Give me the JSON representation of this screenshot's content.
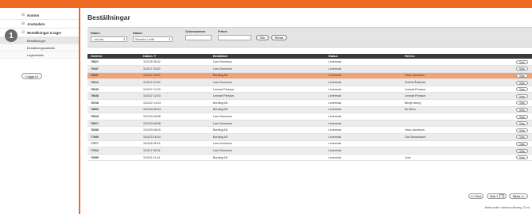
{
  "sidebar": {
    "items": [
      "Konton",
      "Användare",
      "Beställningar & lager"
    ],
    "subitems": [
      "Beställningar",
      "Beställningsstatistik",
      "Lagerstatus"
    ],
    "logout_label": "Logga ut"
  },
  "badge": "1",
  "main": {
    "title": "Beställningar",
    "filters": {
      "status_label": "Status",
      "status_value": "- ald ala -",
      "datum_label": "Datum",
      "datum_value": "Senaste 1 mån",
      "ordernummer_label": "Ordernummer",
      "fritext_label": "Fritext",
      "search_label": "Sök",
      "reset_label": "Rensa"
    },
    "table": {
      "headers": [
        "Ordernr.",
        "Datum ▼",
        "Beställare",
        "Status",
        "Ref./nr.",
        ""
      ],
      "rows": [
        [
          "79821",
          "110125 06:02",
          "Lars Svensson",
          "Levererad",
          "",
          "Visa"
        ],
        [
          "79437",
          "110117 15:00",
          "Lars Svensson",
          "Levererad",
          "",
          "Visa"
        ],
        [
          "79437",
          "110117 15:00",
          "Bording AB",
          "Levererad",
          "Hans Jacobson",
          "Visa"
        ],
        [
          "79214",
          "110112 10:00",
          "Lars Svensson",
          "Levererad",
          "Fredrik Åhlander",
          "Visa"
        ],
        [
          "79040",
          "110107 10:03",
          "Lennart Persson",
          "Levererad",
          "Lennart Persson",
          "Visa"
        ],
        [
          "79038",
          "110107 10:03",
          "Lennart Persson",
          "Levererad",
          "Lennart Persson",
          "Visa"
        ],
        [
          "78768",
          "101222 14:03",
          "Bording AB",
          "Levererad",
          "Bengt Isberg",
          "Visa"
        ],
        [
          "78560",
          "101216 08:44",
          "Bording AB",
          "Levererad",
          "Bo Blom",
          "Visa"
        ],
        [
          "78518",
          "101215 08:56",
          "Lars Svensson",
          "Levererad",
          "",
          "Visa"
        ],
        [
          "78517",
          "101215 08:56",
          "Lars Svensson",
          "Levererad",
          "",
          "Visa"
        ],
        [
          "78288",
          "101209 08:00",
          "Bording AB",
          "Levererad",
          "Hans Jacobson",
          "Visa"
        ],
        [
          "77695",
          "101123 16:04",
          "Bording AB",
          "Levererad",
          "Ola Samuelsson",
          "Visa"
        ],
        [
          "77077",
          "101118 08:43",
          "Lars Svensson",
          "Levererad",
          "",
          "Visa"
        ],
        [
          "77012",
          "101117 06:34",
          "Lars Svensson",
          "Levererad",
          "",
          "Visa"
        ],
        [
          "76959",
          "101116 11:44",
          "Bording AB",
          "Levererad",
          "Jens",
          "Visa"
        ]
      ]
    },
    "pager": {
      "prev_label": "<< Förra",
      "page_label": "Sida 1",
      "page_value": "1",
      "next_label": "Nästa >>"
    },
    "count_text": "Antal order i denna sökning: 21 st"
  },
  "colors": {
    "accent": "#ee6a22",
    "highlight_row": "#f2a27a",
    "header_bg": "#3a3a3a"
  }
}
